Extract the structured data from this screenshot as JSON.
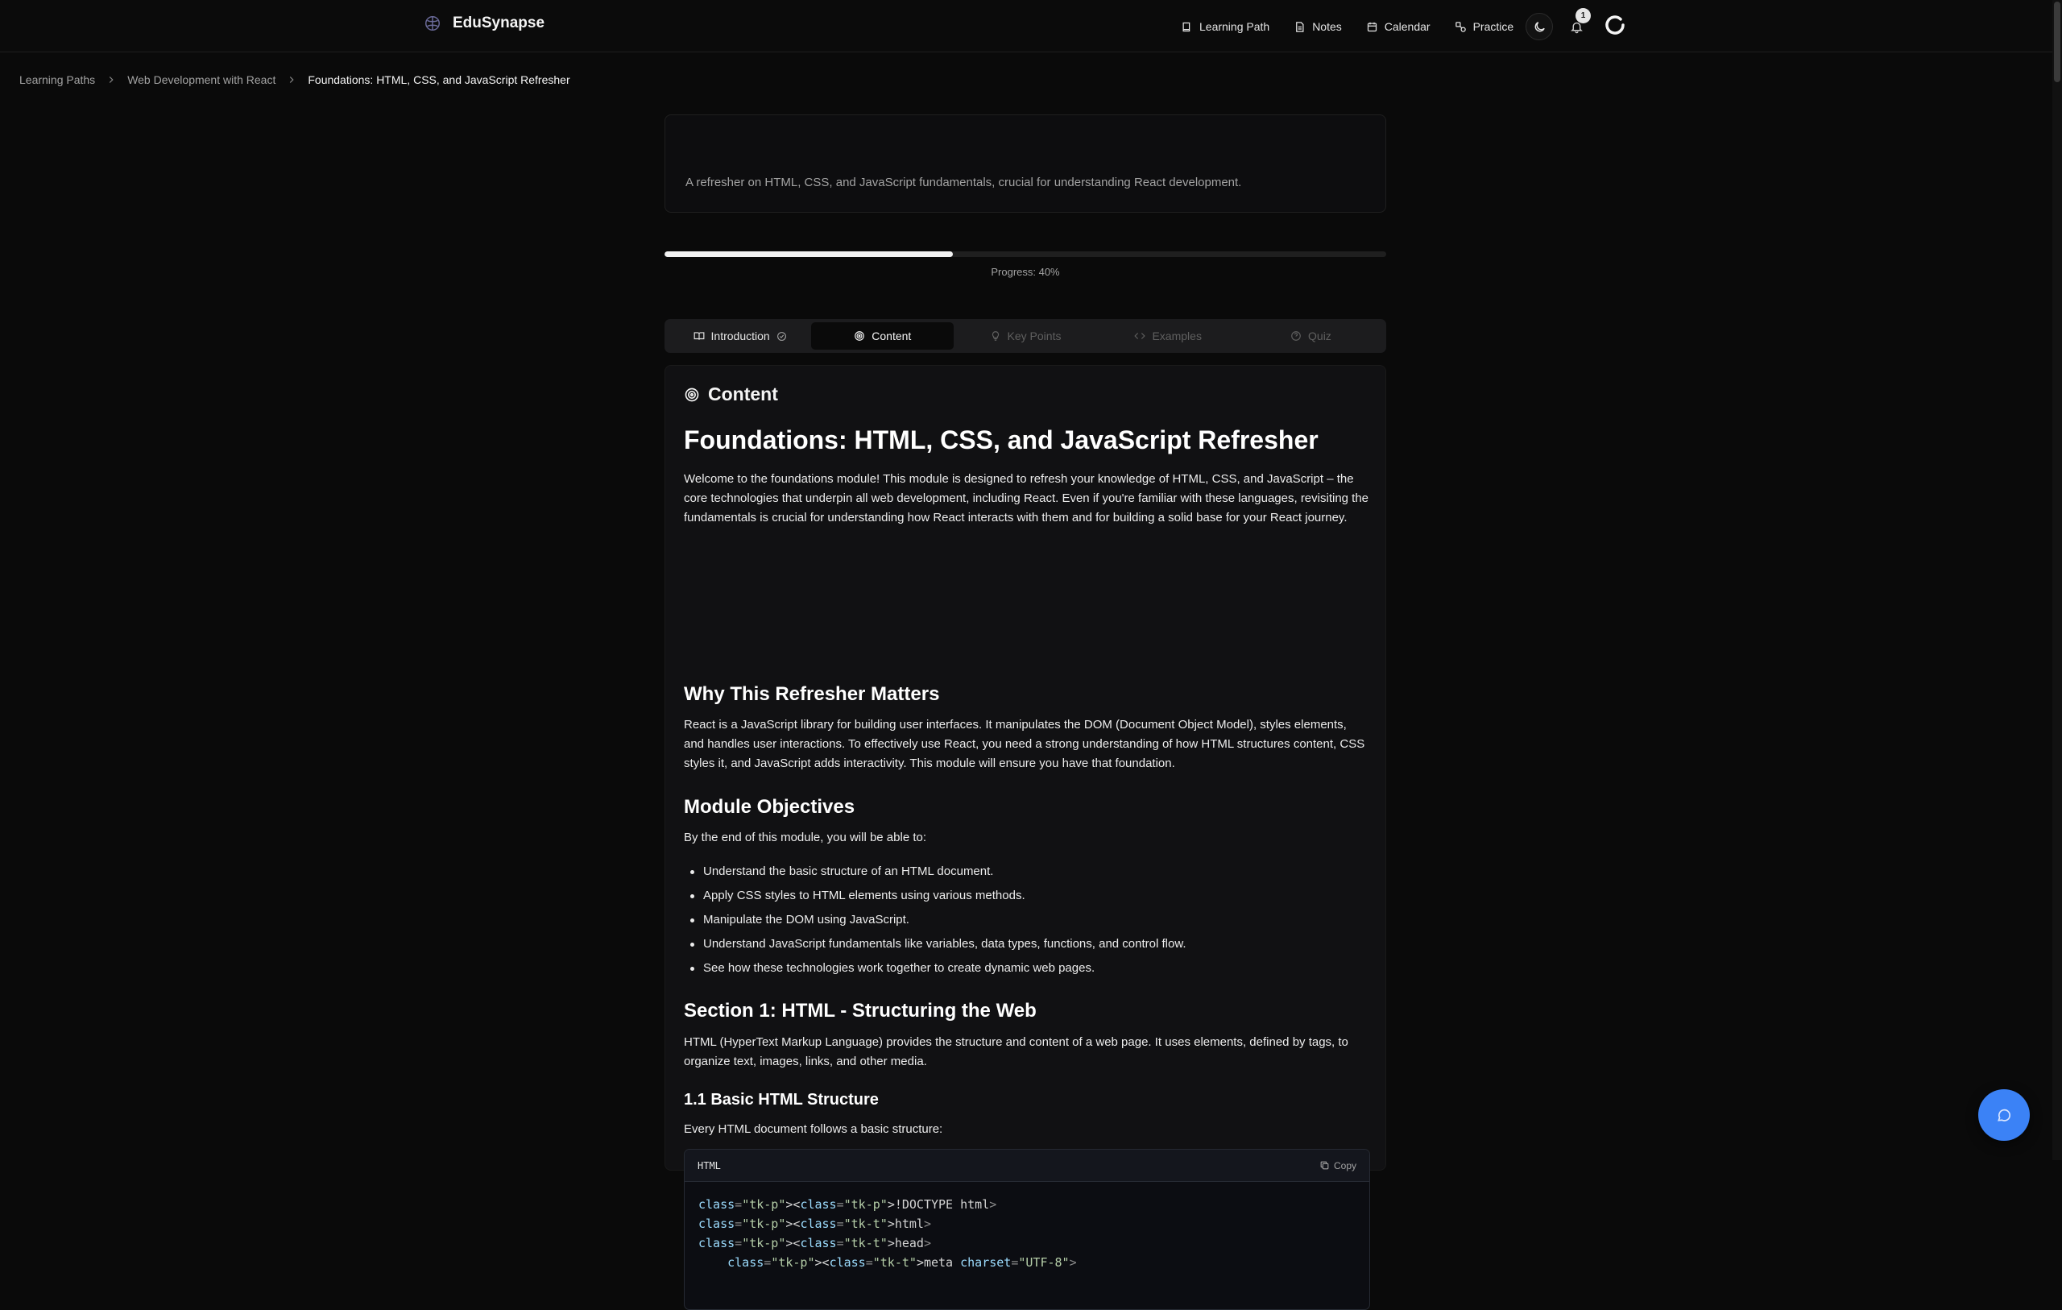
{
  "header": {
    "brand": "EduSynapse",
    "nav": [
      {
        "label": "Learning Path",
        "icon": "book-icon"
      },
      {
        "label": "Notes",
        "icon": "file-icon"
      },
      {
        "label": "Calendar",
        "icon": "calendar-icon"
      },
      {
        "label": "Practice",
        "icon": "practice-icon"
      }
    ],
    "notification_count": "1"
  },
  "breadcrumb": [
    "Learning Paths",
    "Web Development with React",
    "Foundations: HTML, CSS, and JavaScript Refresher"
  ],
  "module": {
    "description": "A refresher on HTML, CSS, and JavaScript fundamentals, crucial for understanding React development.",
    "progress_percent": 40,
    "progress_label": "Progress: 40%"
  },
  "tabs": [
    {
      "label": "Introduction",
      "state": "done"
    },
    {
      "label": "Content",
      "state": "active"
    },
    {
      "label": "Key Points",
      "state": "disabled"
    },
    {
      "label": "Examples",
      "state": "disabled"
    },
    {
      "label": "Quiz",
      "state": "disabled"
    }
  ],
  "content": {
    "heading": "Content",
    "title": "Foundations: HTML, CSS, and JavaScript Refresher",
    "intro": "Welcome to the foundations module! This module is designed to refresh your knowledge of HTML, CSS, and JavaScript – the core technologies that underpin all web development, including React. Even if you're familiar with these languages, revisiting the fundamentals is crucial for understanding how React interacts with them and for building a solid base for your React journey.",
    "why_heading": "Why This Refresher Matters",
    "why_text": "React is a JavaScript library for building user interfaces. It manipulates the DOM (Document Object Model), styles elements, and handles user interactions. To effectively use React, you need a strong understanding of how HTML structures content, CSS styles it, and JavaScript adds interactivity. This module will ensure you have that foundation.",
    "objectives_heading": "Module Objectives",
    "objectives_intro": "By the end of this module, you will be able to:",
    "objectives": [
      "Understand the basic structure of an HTML document.",
      "Apply CSS styles to HTML elements using various methods.",
      "Manipulate the DOM using JavaScript.",
      "Understand JavaScript fundamentals like variables, data types, functions, and control flow.",
      "See how these technologies work together to create dynamic web pages."
    ],
    "section1_heading": "Section 1: HTML - Structuring the Web",
    "section1_text": "HTML (HyperText Markup Language) provides the structure and content of a web page. It uses elements, defined by tags, to organize text, images, links, and other media.",
    "subsection_heading": "1.1 Basic HTML Structure",
    "subsection_text": "Every HTML document follows a basic structure:",
    "code": {
      "language": "HTML",
      "copy_label": "Copy",
      "lines": [
        "<!DOCTYPE html>",
        "<html>",
        "<head>",
        "    <meta charset=\"UTF-8\">"
      ]
    }
  },
  "colors": {
    "accent": "#3b82f6",
    "background": "#0a0a0a",
    "card": "#111113"
  }
}
